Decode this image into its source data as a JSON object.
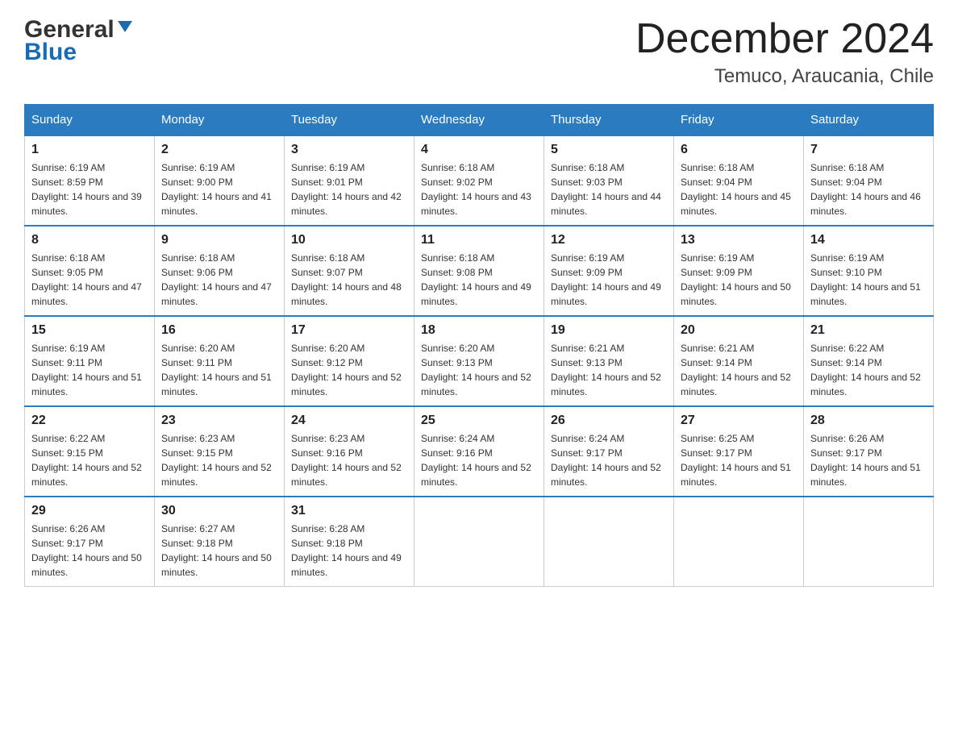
{
  "header": {
    "logo_general": "General",
    "logo_blue": "Blue",
    "month_title": "December 2024",
    "location": "Temuco, Araucania, Chile"
  },
  "days_of_week": [
    "Sunday",
    "Monday",
    "Tuesday",
    "Wednesday",
    "Thursday",
    "Friday",
    "Saturday"
  ],
  "weeks": [
    [
      {
        "day": "1",
        "sunrise": "6:19 AM",
        "sunset": "8:59 PM",
        "daylight": "14 hours and 39 minutes."
      },
      {
        "day": "2",
        "sunrise": "6:19 AM",
        "sunset": "9:00 PM",
        "daylight": "14 hours and 41 minutes."
      },
      {
        "day": "3",
        "sunrise": "6:19 AM",
        "sunset": "9:01 PM",
        "daylight": "14 hours and 42 minutes."
      },
      {
        "day": "4",
        "sunrise": "6:18 AM",
        "sunset": "9:02 PM",
        "daylight": "14 hours and 43 minutes."
      },
      {
        "day": "5",
        "sunrise": "6:18 AM",
        "sunset": "9:03 PM",
        "daylight": "14 hours and 44 minutes."
      },
      {
        "day": "6",
        "sunrise": "6:18 AM",
        "sunset": "9:04 PM",
        "daylight": "14 hours and 45 minutes."
      },
      {
        "day": "7",
        "sunrise": "6:18 AM",
        "sunset": "9:04 PM",
        "daylight": "14 hours and 46 minutes."
      }
    ],
    [
      {
        "day": "8",
        "sunrise": "6:18 AM",
        "sunset": "9:05 PM",
        "daylight": "14 hours and 47 minutes."
      },
      {
        "day": "9",
        "sunrise": "6:18 AM",
        "sunset": "9:06 PM",
        "daylight": "14 hours and 47 minutes."
      },
      {
        "day": "10",
        "sunrise": "6:18 AM",
        "sunset": "9:07 PM",
        "daylight": "14 hours and 48 minutes."
      },
      {
        "day": "11",
        "sunrise": "6:18 AM",
        "sunset": "9:08 PM",
        "daylight": "14 hours and 49 minutes."
      },
      {
        "day": "12",
        "sunrise": "6:19 AM",
        "sunset": "9:09 PM",
        "daylight": "14 hours and 49 minutes."
      },
      {
        "day": "13",
        "sunrise": "6:19 AM",
        "sunset": "9:09 PM",
        "daylight": "14 hours and 50 minutes."
      },
      {
        "day": "14",
        "sunrise": "6:19 AM",
        "sunset": "9:10 PM",
        "daylight": "14 hours and 51 minutes."
      }
    ],
    [
      {
        "day": "15",
        "sunrise": "6:19 AM",
        "sunset": "9:11 PM",
        "daylight": "14 hours and 51 minutes."
      },
      {
        "day": "16",
        "sunrise": "6:20 AM",
        "sunset": "9:11 PM",
        "daylight": "14 hours and 51 minutes."
      },
      {
        "day": "17",
        "sunrise": "6:20 AM",
        "sunset": "9:12 PM",
        "daylight": "14 hours and 52 minutes."
      },
      {
        "day": "18",
        "sunrise": "6:20 AM",
        "sunset": "9:13 PM",
        "daylight": "14 hours and 52 minutes."
      },
      {
        "day": "19",
        "sunrise": "6:21 AM",
        "sunset": "9:13 PM",
        "daylight": "14 hours and 52 minutes."
      },
      {
        "day": "20",
        "sunrise": "6:21 AM",
        "sunset": "9:14 PM",
        "daylight": "14 hours and 52 minutes."
      },
      {
        "day": "21",
        "sunrise": "6:22 AM",
        "sunset": "9:14 PM",
        "daylight": "14 hours and 52 minutes."
      }
    ],
    [
      {
        "day": "22",
        "sunrise": "6:22 AM",
        "sunset": "9:15 PM",
        "daylight": "14 hours and 52 minutes."
      },
      {
        "day": "23",
        "sunrise": "6:23 AM",
        "sunset": "9:15 PM",
        "daylight": "14 hours and 52 minutes."
      },
      {
        "day": "24",
        "sunrise": "6:23 AM",
        "sunset": "9:16 PM",
        "daylight": "14 hours and 52 minutes."
      },
      {
        "day": "25",
        "sunrise": "6:24 AM",
        "sunset": "9:16 PM",
        "daylight": "14 hours and 52 minutes."
      },
      {
        "day": "26",
        "sunrise": "6:24 AM",
        "sunset": "9:17 PM",
        "daylight": "14 hours and 52 minutes."
      },
      {
        "day": "27",
        "sunrise": "6:25 AM",
        "sunset": "9:17 PM",
        "daylight": "14 hours and 51 minutes."
      },
      {
        "day": "28",
        "sunrise": "6:26 AM",
        "sunset": "9:17 PM",
        "daylight": "14 hours and 51 minutes."
      }
    ],
    [
      {
        "day": "29",
        "sunrise": "6:26 AM",
        "sunset": "9:17 PM",
        "daylight": "14 hours and 50 minutes."
      },
      {
        "day": "30",
        "sunrise": "6:27 AM",
        "sunset": "9:18 PM",
        "daylight": "14 hours and 50 minutes."
      },
      {
        "day": "31",
        "sunrise": "6:28 AM",
        "sunset": "9:18 PM",
        "daylight": "14 hours and 49 minutes."
      },
      null,
      null,
      null,
      null
    ]
  ]
}
